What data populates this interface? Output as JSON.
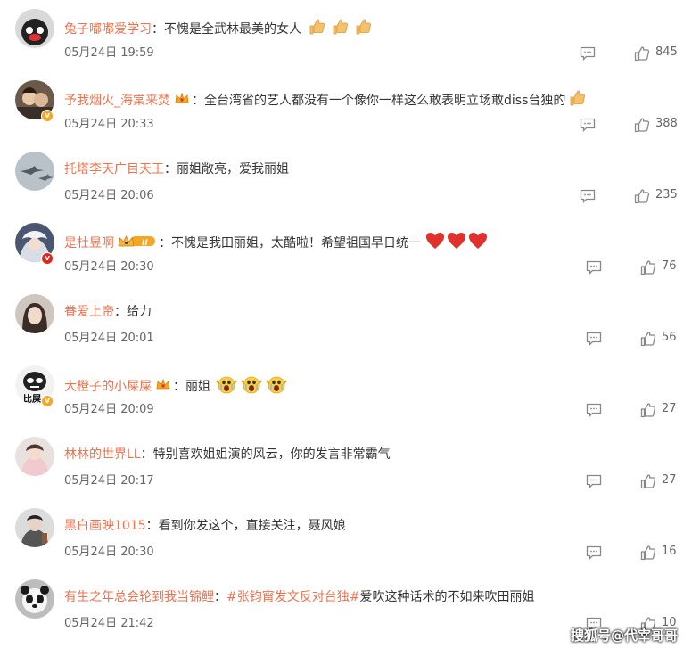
{
  "colors": {
    "username": "#eb7350",
    "text": "#333333",
    "meta": "#666666",
    "verified_gold": "#f5a623",
    "verified_red": "#e0261d",
    "heart": "#e0312c"
  },
  "icons": {
    "reply": "comment-icon",
    "like": "thumbs-up-icon",
    "thumbs_emoji": "thumbs-up-emoji",
    "heart_emoji": "red-heart-emoji",
    "crown_badge": "crown-badge-icon",
    "scream_emoji": "screaming-face-emoji"
  },
  "separator": "：",
  "comments": [
    {
      "username": "兔子嘟嘟爱学习",
      "text": "不愧是全武林最美的女人",
      "time": "05月24日 19:59",
      "likes": "845"
    },
    {
      "username": "予我烟火_海棠来焚",
      "text": "全台湾省的艺人都没有一个像你一样这么敢表明立场敢diss台独的",
      "time": "05月24日 20:33",
      "likes": "388"
    },
    {
      "username": "托塔李天广目天王",
      "text": "丽姐敞亮，爱我丽姐",
      "time": "05月24日 20:06",
      "likes": "235"
    },
    {
      "username": "是杜昱啊",
      "text": "不愧是我田丽姐，太酷啦！希望祖国早日统一",
      "time": "05月24日 20:30",
      "likes": "76",
      "badge_level": "II"
    },
    {
      "username": "眷爱上帝",
      "text": "给力",
      "time": "05月24日 20:01",
      "likes": "56"
    },
    {
      "username": "大橙子的小屎屎",
      "text": "丽姐",
      "time": "05月24日 20:09",
      "likes": "27",
      "avatar_text": "比屎"
    },
    {
      "username": "林林的世界LL",
      "text": "特别喜欢姐姐演的风云，你的发言非常霸气",
      "time": "05月24日 20:17",
      "likes": "27"
    },
    {
      "username": "黑白画映1015",
      "text": "看到你发这个，直接关注，聂风娘",
      "time": "05月24日 20:30",
      "likes": "16"
    },
    {
      "username": "有生之年总会轮到我当锦鲤",
      "topic": "#张钧甯发文反对台独#",
      "text": "爱吹这种话术的不如来吹田丽姐",
      "time": "05月24日 21:42",
      "likes": "10"
    }
  ],
  "watermark": "搜狐号@代宰哥哥"
}
